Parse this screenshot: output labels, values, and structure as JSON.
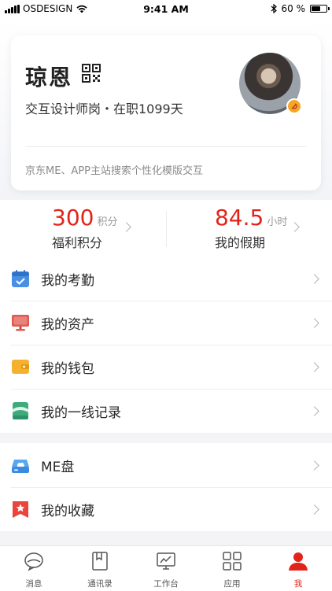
{
  "status_bar": {
    "carrier": "OSDESIGN",
    "time": "9:41 AM",
    "battery": "60 %"
  },
  "profile": {
    "name": "琼恩",
    "title": "交互设计师岗・在职1099天",
    "description": "京东ME、APP主站搜索个性化模版交互"
  },
  "stats": [
    {
      "value": "300",
      "unit": "积分",
      "label": "福利积分"
    },
    {
      "value": "84.5",
      "unit": "小时",
      "label": "我的假期"
    }
  ],
  "menu_group_1": [
    {
      "label": "我的考勤",
      "icon": "calendar-icon"
    },
    {
      "label": "我的资产",
      "icon": "monitor-icon"
    },
    {
      "label": "我的钱包",
      "icon": "wallet-icon"
    },
    {
      "label": "我的一线记录",
      "icon": "notebook-icon"
    }
  ],
  "menu_group_2": [
    {
      "label": "ME盘",
      "icon": "cloud-drive-icon"
    },
    {
      "label": "我的收藏",
      "icon": "bookmark-star-icon"
    }
  ],
  "tabs": [
    {
      "label": "消息",
      "icon": "message-icon"
    },
    {
      "label": "通讯录",
      "icon": "contacts-icon"
    },
    {
      "label": "工作台",
      "icon": "workbench-icon"
    },
    {
      "label": "应用",
      "icon": "apps-icon"
    },
    {
      "label": "我",
      "icon": "person-icon",
      "active": true
    }
  ],
  "colors": {
    "accent": "#e2231a",
    "badge": "#f5a623"
  }
}
